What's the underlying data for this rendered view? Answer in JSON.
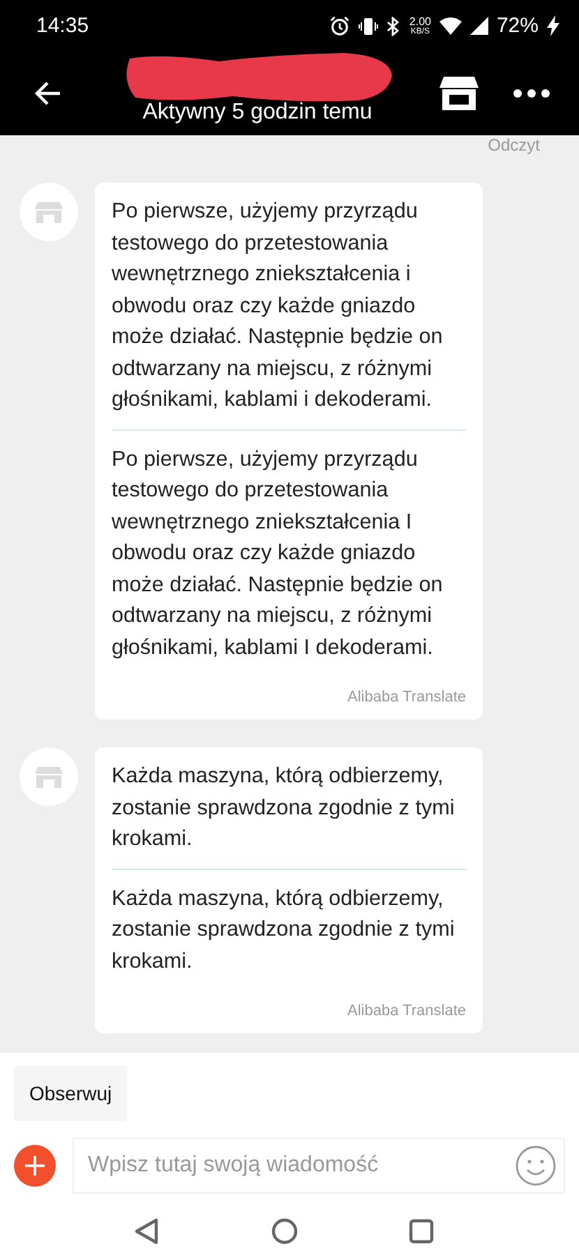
{
  "status_bar": {
    "time": "14:35",
    "speed_value": "2.00",
    "speed_unit": "KB/S",
    "battery": "72%"
  },
  "header": {
    "subtitle": "Aktywny 5 godzin temu"
  },
  "read_receipt": "Odczyt",
  "messages": [
    {
      "original": "Po pierwsze, użyjemy przyrządu testowego do przetestowania wewnętrznego zniekształcenia i obwodu oraz czy każde gniazdo może działać. Następnie będzie on odtwarzany na miejscu, z różnymi głośnikami, kablami i dekoderami.",
      "translation": "Po pierwsze, użyjemy przyrządu testowego do przetestowania wewnętrznego zniekształcenia I obwodu oraz czy każde gniazdo może działać. Następnie będzie on odtwarzany na miejscu, z różnymi głośnikami, kablami I dekoderami.",
      "source": "Alibaba Translate"
    },
    {
      "original": "Każda maszyna, którą odbierzemy, zostanie sprawdzona zgodnie z tymi krokami.",
      "translation": "Każda maszyna, którą odbierzemy, zostanie sprawdzona zgodnie z tymi krokami.",
      "source": "Alibaba Translate"
    }
  ],
  "follow_button": "Obserwuj",
  "composer": {
    "placeholder": "Wpisz tutaj swoją wiadomość"
  }
}
